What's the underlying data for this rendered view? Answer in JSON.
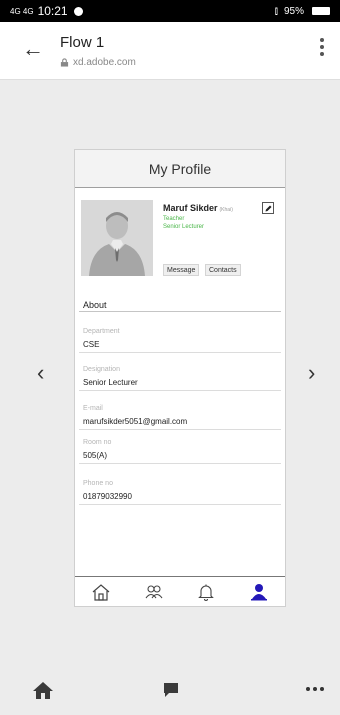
{
  "status_bar": {
    "signal": "4G 4G",
    "time": "10:21",
    "right": "95%"
  },
  "browser": {
    "title": "Flow 1",
    "url": "xd.adobe.com"
  },
  "profile": {
    "header_title": "My Profile",
    "name": "Maruf Sikder",
    "name_suffix": "(Khai)",
    "role": "Teacher",
    "designation_short": "Senior Lecturer",
    "message_label": "Message",
    "contacts_label": "Contacts",
    "about_label": "About",
    "fields": [
      {
        "label": "Department",
        "value": "CSE"
      },
      {
        "label": "Designation",
        "value": "Senior Lecturer"
      },
      {
        "label": "E-mail",
        "value": "marufsikder5051@gmail.com"
      },
      {
        "label": "Room no",
        "value": "505(A)"
      },
      {
        "label": "Phone no",
        "value": "01879032990"
      }
    ]
  },
  "tabs": [
    {
      "icon": "home-icon"
    },
    {
      "icon": "people-icon"
    },
    {
      "icon": "bell-icon"
    },
    {
      "icon": "person-icon",
      "active": true
    }
  ],
  "colors": {
    "accent_green": "#49b648",
    "active_tab": "#2318b8"
  }
}
